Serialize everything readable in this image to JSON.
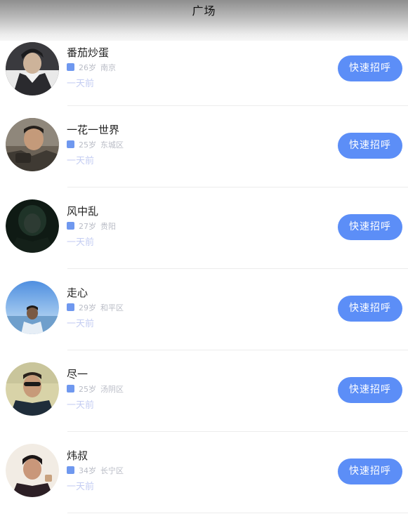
{
  "header": {
    "title": "广场"
  },
  "users": [
    {
      "name": "番茄炒蛋",
      "age": "26岁",
      "location": "南京",
      "time": "一天前",
      "action": "快速招呼"
    },
    {
      "name": "一花一世界",
      "age": "25岁",
      "location": "东城区",
      "time": "一天前",
      "action": "快速招呼"
    },
    {
      "name": "风中乱",
      "age": "27岁",
      "location": "贵阳",
      "time": "一天前",
      "action": "快速招呼"
    },
    {
      "name": "走心",
      "age": "29岁",
      "location": "和平区",
      "time": "一天前",
      "action": "快速招呼"
    },
    {
      "name": "尽一",
      "age": "25岁",
      "location": "汤阴区",
      "time": "一天前",
      "action": "快速招呼"
    },
    {
      "name": "炜叔",
      "age": "34岁",
      "location": "长宁区",
      "time": "一天前",
      "action": "快速招呼"
    }
  ],
  "colors": {
    "accent": "#5c8ef7",
    "gender_icon": "#6f98ef",
    "meta_text": "#b9bcc6",
    "time_text": "#c4cdf2"
  }
}
